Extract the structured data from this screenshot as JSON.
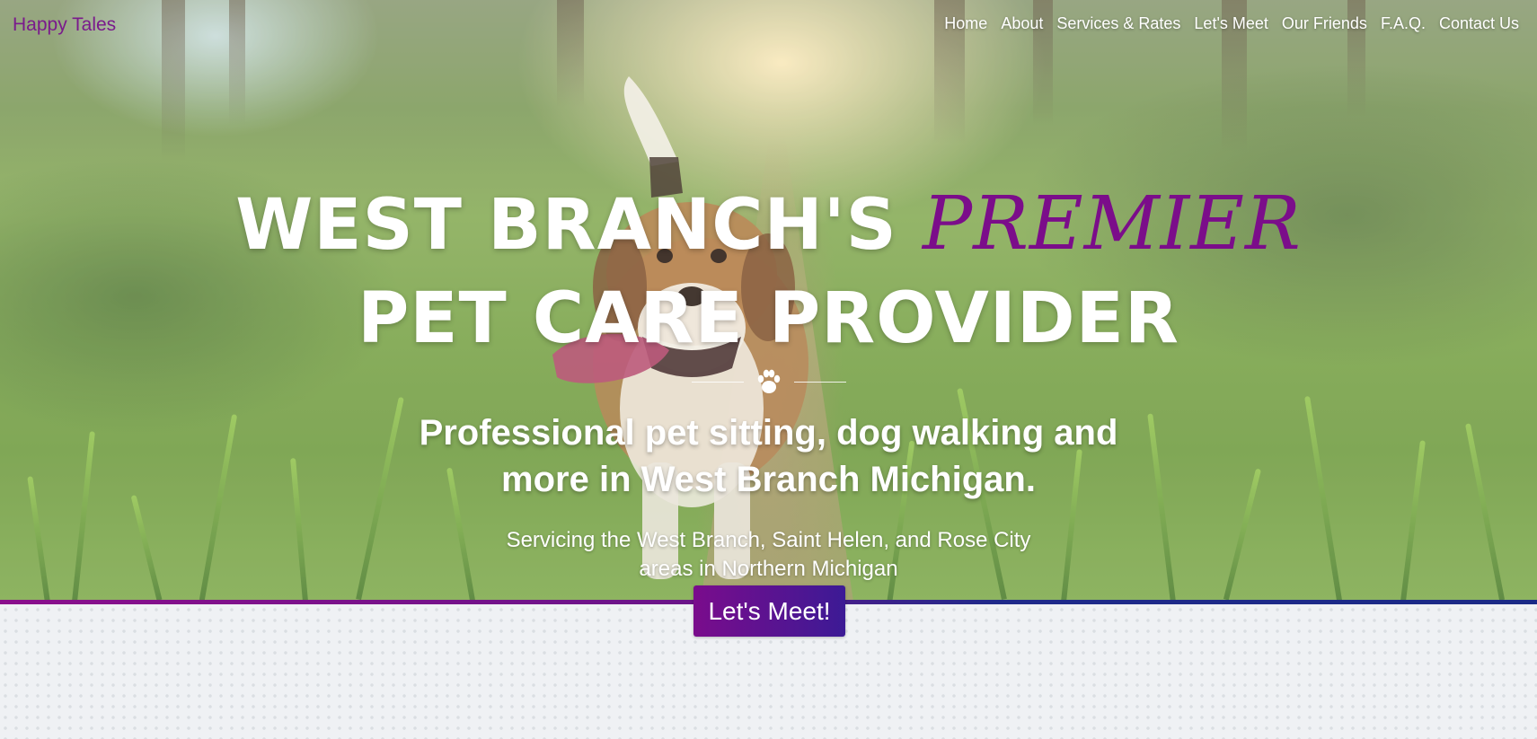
{
  "header": {
    "brand": "Happy Tales",
    "nav": [
      {
        "label": "Home"
      },
      {
        "label": "About"
      },
      {
        "label": "Services & Rates"
      },
      {
        "label": "Let's Meet"
      },
      {
        "label": "Our Friends"
      },
      {
        "label": "F.A.Q."
      },
      {
        "label": "Contact Us"
      }
    ]
  },
  "hero": {
    "headline_part1": "WEST BRANCH'S",
    "headline_highlight": "PREMIER",
    "headline_part2": "PET CARE PROVIDER",
    "subhead_line1": "Professional pet sitting, dog walking and",
    "subhead_line2": "more in West Branch Michigan.",
    "service_line1": "Servicing the West Branch, Saint Helen, and Rose City",
    "service_line2": "areas in Northern Michigan",
    "cta_label": "Let's Meet!",
    "divider_icon": "paw-icon"
  },
  "colors": {
    "brand_purple": "#7b0d8a",
    "button_start": "#7a0c8c",
    "button_end": "#3c1a95",
    "border_blue": "#1b2a86",
    "text_white": "#ffffff"
  }
}
